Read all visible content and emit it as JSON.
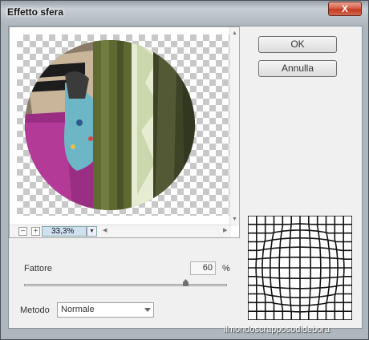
{
  "dialog": {
    "title": "Effetto sfera",
    "close_label": "X"
  },
  "buttons": {
    "ok_label": "OK",
    "cancel_label": "Annulla"
  },
  "preview": {
    "zoom_out_label": "−",
    "zoom_in_label": "+",
    "zoom_value": "33,3%"
  },
  "settings": {
    "amount_label": "Fattore",
    "amount_value": "60",
    "amount_unit": "%",
    "amount_slider_level": 0.8,
    "mode_label": "Metodo",
    "mode_value": "Normale"
  },
  "watermark": "ilmondoscrapposodidebora",
  "icons": {
    "close": "close-icon",
    "scroll_up": "scroll-up-icon",
    "scroll_down": "scroll-down-icon",
    "scroll_left": "scroll-left-icon",
    "scroll_right": "scroll-right-icon",
    "dropdown": "chevron-down-icon"
  },
  "colors": {
    "zoom_field": "#cfe0ee",
    "close_button": "#c23a22",
    "client_background": "#f0f0f0"
  }
}
